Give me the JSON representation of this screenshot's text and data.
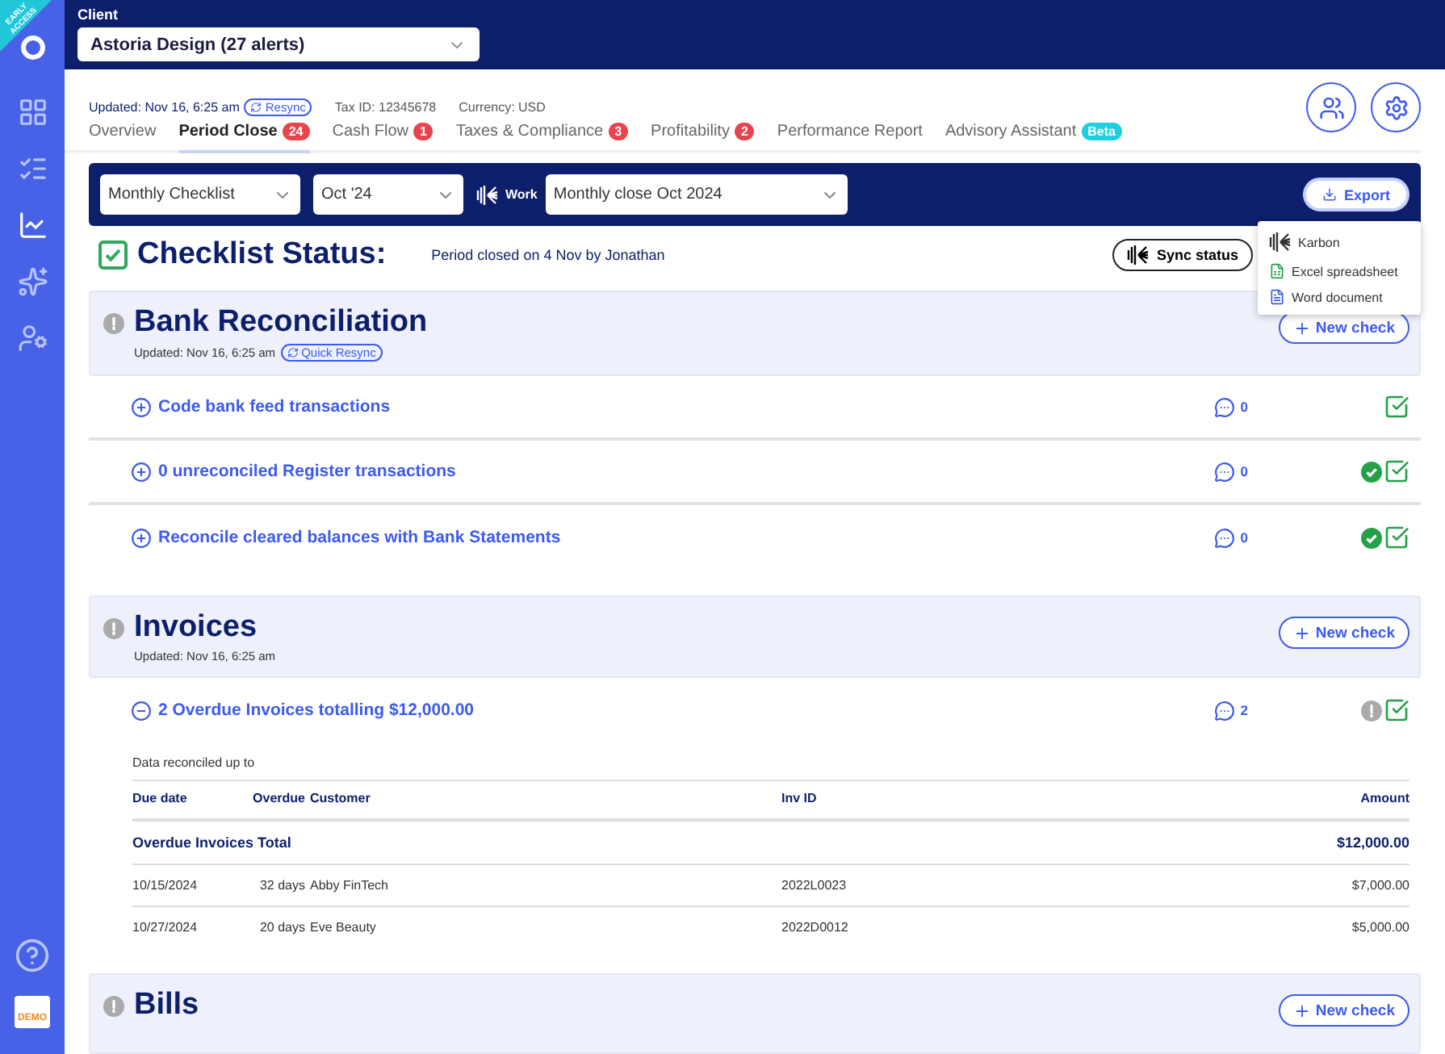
{
  "sidebar": {
    "ribbon": "EARLY ACCESS",
    "items": [
      {
        "kind": "grid",
        "selected": false
      },
      {
        "kind": "checklist",
        "selected": false
      },
      {
        "kind": "chart",
        "selected": true
      },
      {
        "kind": "sparkles",
        "selected": false
      },
      {
        "kind": "user-settings",
        "selected": false
      }
    ],
    "logo_text": "DEMO"
  },
  "client": {
    "label": "Client",
    "value": "Astoria Design (27 alerts)"
  },
  "info": {
    "updated": "Updated: Nov 16, 6:25 am",
    "resync": "Resync",
    "tax_id": "Tax ID: 12345678",
    "currency": "Currency: USD"
  },
  "tabs": [
    {
      "label": "Overview",
      "selected": false
    },
    {
      "label": "Period Close",
      "badge": "24",
      "selected": true
    },
    {
      "label": "Cash Flow",
      "badge": "1",
      "selected": false
    },
    {
      "label": "Taxes & Compliance",
      "badge": "3",
      "selected": false
    },
    {
      "label": "Profitability",
      "badge": "2",
      "selected": false
    },
    {
      "label": "Performance Report",
      "selected": false
    },
    {
      "label": "Advisory Assistant",
      "tag": "Beta",
      "selected": false
    }
  ],
  "toolbar": {
    "checklist": "Monthly Checklist",
    "period": "Oct '24",
    "work_label": "Work",
    "work": "Monthly close Oct 2024",
    "export": "Export"
  },
  "export_menu": [
    {
      "label": "Karbon",
      "kind": "karbon"
    },
    {
      "label": "Excel spreadsheet",
      "kind": "excel"
    },
    {
      "label": "Word document",
      "kind": "word"
    }
  ],
  "status": {
    "title": "Checklist Status:",
    "checked": true,
    "note": "Period closed on 4 Nov by Jonathan",
    "sync": "Sync status"
  },
  "sections": [
    {
      "title": "Bank Reconciliation",
      "updated": "Updated: Nov 16, 6:25 am",
      "resync": "Quick Resync",
      "new_check": "New check",
      "checks": [
        {
          "label": "Code bank feed transactions",
          "expanded": false,
          "comments": "0",
          "passed": false,
          "alert": false,
          "checked": true
        },
        {
          "label": "0 unreconciled Register transactions",
          "expanded": false,
          "comments": "0",
          "passed": true,
          "alert": false,
          "checked": true
        },
        {
          "label": "Reconcile cleared balances with Bank Statements",
          "expanded": false,
          "comments": "0",
          "passed": true,
          "alert": false,
          "checked": true
        }
      ]
    },
    {
      "title": "Invoices",
      "updated": "Updated: Nov 16, 6:25 am",
      "new_check": "New check",
      "checks": [
        {
          "label": "2 Overdue Invoices totalling $12,000.00",
          "expanded": true,
          "comments": "2",
          "passed": false,
          "alert": true,
          "checked": true,
          "detail": {
            "note": "Data reconciled up to",
            "columns": [
              "Due date",
              "Overdue",
              "Customer",
              "Inv ID",
              "Amount"
            ],
            "total": {
              "label": "Overdue Invoices Total",
              "amount": "$12,000.00"
            },
            "rows": [
              [
                "10/15/2024",
                "32 days",
                "Abby FinTech",
                "2022L0023",
                "$7,000.00"
              ],
              [
                "10/27/2024",
                "20 days",
                "Eve Beauty",
                "2022D0012",
                "$5,000.00"
              ]
            ]
          }
        }
      ]
    },
    {
      "title": "Bills",
      "new_check": "New check"
    }
  ]
}
